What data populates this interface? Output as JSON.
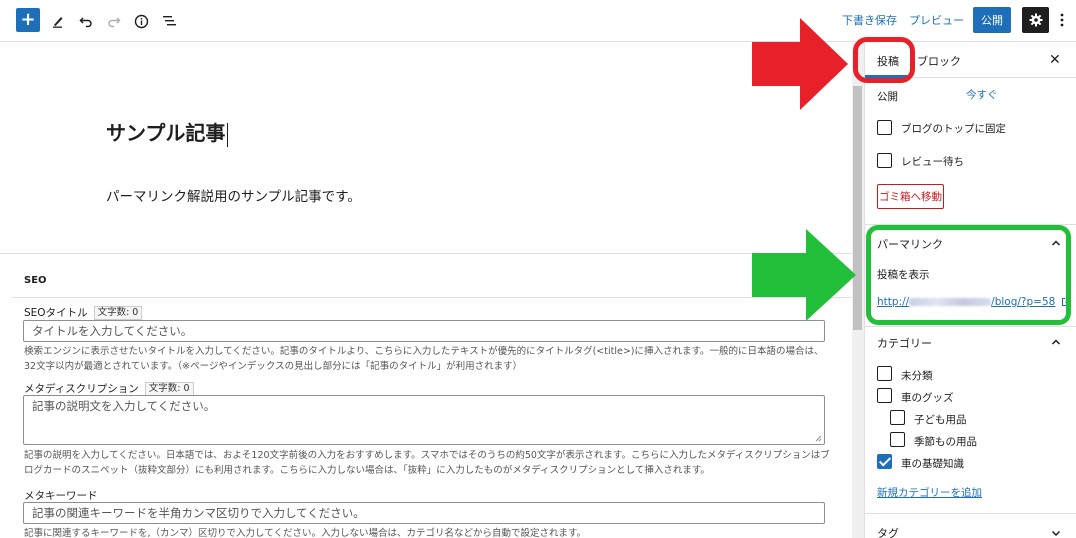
{
  "toolbar": {
    "add_icon": "plus-icon",
    "draft_label": "下書き保存",
    "preview_label": "プレビュー",
    "publish_label": "公開"
  },
  "editor": {
    "title": "サンプル記事",
    "body": "パーマリンク解説用のサンプル記事です。"
  },
  "seo": {
    "heading": "SEO",
    "title_field": {
      "label": "SEOタイトル",
      "counter": "文字数: 0",
      "placeholder": "タイトルを入力してください。",
      "help": "検索エンジンに表示させたいタイトルを入力してください。記事のタイトルより、こちらに入力したテキストが優先的にタイトルタグ(<title>)に挿入されます。一般的に日本語の場合は、32文字以内が最適とされています。（※ページやインデックスの見出し部分には「記事のタイトル」が利用されます）"
    },
    "description_field": {
      "label": "メタディスクリプション",
      "counter": "文字数: 0",
      "placeholder": "記事の説明文を入力してください。",
      "help": "記事の説明を入力してください。日本語では、およそ120文字前後の入力をおすすめします。スマホではそのうちの約50文字が表示されます。こちらに入力したメタディスクリプションはブログカードのスニペット（抜粋文部分）にも利用されます。こちらに入力しない場合は、「抜粋」に入力したものがメタディスクリプションとして挿入されます。"
    },
    "keyword_field": {
      "label": "メタキーワード",
      "placeholder": "記事の関連キーワードを半角カンマ区切りで入力してください。",
      "help": "記事に関連するキーワードを,（カンマ）区切りで入力してください。入力しない場合は、カテゴリ名などから自動で設定されます。"
    }
  },
  "sidebar": {
    "tab_post": "投稿",
    "tab_block": "ブロック",
    "visibility_label": "公開",
    "visibility_value": "今すぐ",
    "sticky_label": "ブログのトップに固定",
    "pending_label": "レビュー待ち",
    "trash_label": "ゴミ箱へ移動",
    "permalink": {
      "title": "パーマリンク",
      "view_label": "投稿を表示",
      "url_prefix": "http://",
      "url_suffix": "/blog/?p=58"
    },
    "categories": {
      "title": "カテゴリー",
      "items": [
        {
          "label": "未分類",
          "checked": false
        },
        {
          "label": "車のグッズ",
          "checked": false
        },
        {
          "label": "子ども用品",
          "checked": false
        },
        {
          "label": "季節もの用品",
          "checked": false
        },
        {
          "label": "車の基礎知識",
          "checked": true
        }
      ],
      "add_new_label": "新規カテゴリーを追加"
    },
    "tags_title": "タグ"
  },
  "colors": {
    "accent": "#1e6fba",
    "annotation_red": "#e8202a",
    "annotation_green": "#22c03a",
    "danger": "#cc1818"
  }
}
